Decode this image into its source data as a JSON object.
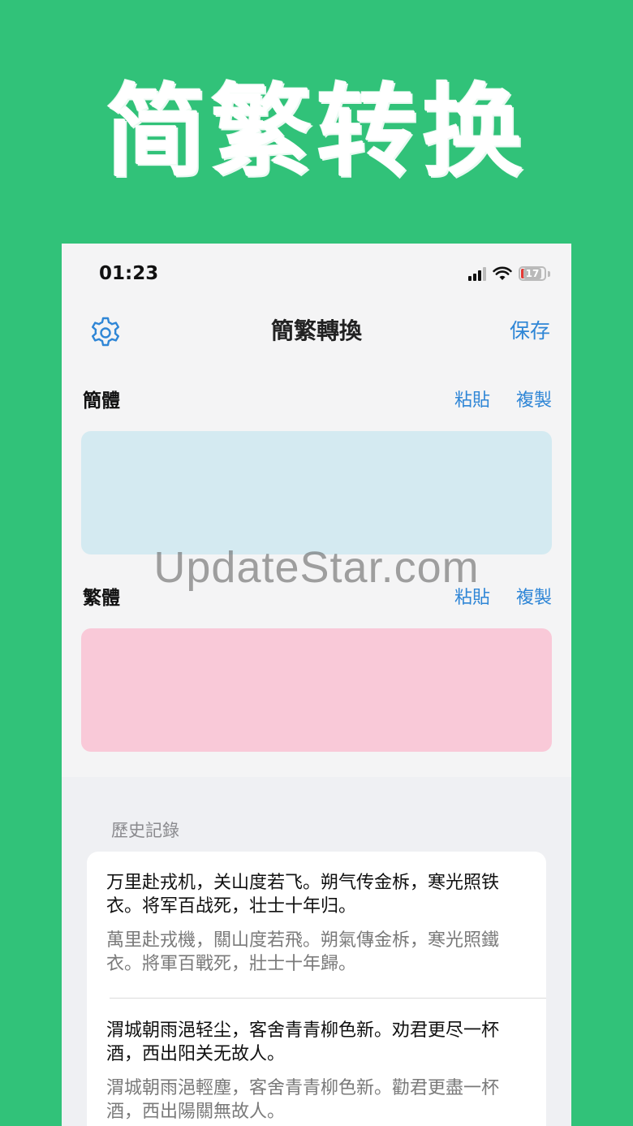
{
  "hero": {
    "title": "简繁转换"
  },
  "status_bar": {
    "time": "01:23",
    "battery_level": "17"
  },
  "nav": {
    "title": "簡繁轉換",
    "save_label": "保存"
  },
  "simplified_section": {
    "label": "簡體",
    "paste_label": "粘貼",
    "copy_label": "複製",
    "value": ""
  },
  "traditional_section": {
    "label": "繁體",
    "paste_label": "粘貼",
    "copy_label": "複製",
    "value": ""
  },
  "watermark": "UpdateStar.com",
  "history": {
    "title": "歷史記錄",
    "items": [
      {
        "simplified": "万里赴戎机，关山度若飞。朔气传金柝，寒光照铁衣。将军百战死，壮士十年归。",
        "traditional": "萬里赴戎機，關山度若飛。朔氣傳金柝，寒光照鐵衣。將軍百戰死，壯士十年歸。"
      },
      {
        "simplified": "渭城朝雨浥轻尘，客舍青青柳色新。劝君更尽一杯酒，西出阳关无故人。",
        "traditional": "渭城朝雨浥輕塵，客舍青青柳色新。勸君更盡一杯酒，西出陽關無故人。"
      }
    ]
  },
  "colors": {
    "background": "#31c279",
    "accent": "#2f86d6",
    "simplified_box": "#d4eaf1",
    "traditional_box": "#f9c9d8"
  },
  "icons": [
    "gear-icon",
    "signal-icon",
    "wifi-icon",
    "battery-icon"
  ]
}
